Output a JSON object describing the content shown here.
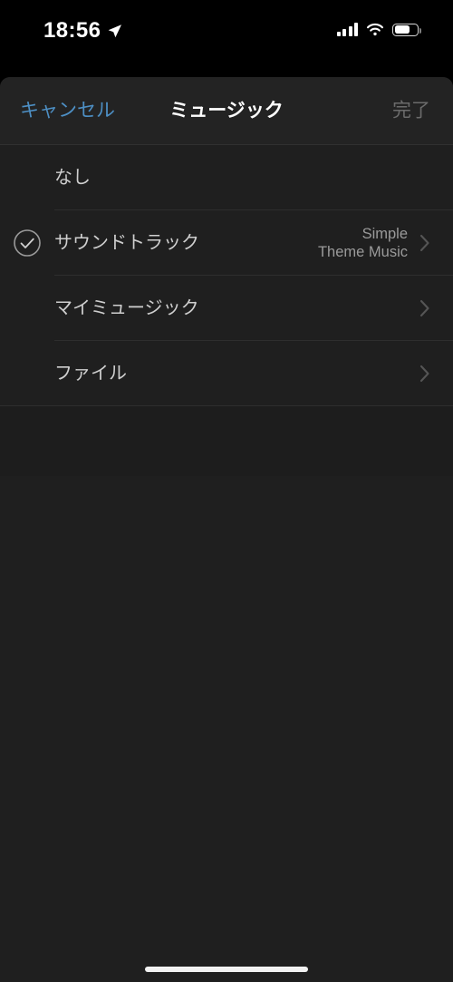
{
  "status_bar": {
    "time": "18:56",
    "location_icon": "location-arrow-icon",
    "signal_icon": "cellular-signal-icon",
    "signal_bars_filled": 4,
    "wifi_icon": "wifi-icon",
    "battery_icon": "battery-icon",
    "battery_level_percent": 62
  },
  "nav_bar": {
    "cancel_label": "キャンセル",
    "title": "ミュージック",
    "done_label": "完了",
    "cancel_color": "#4d8fc4",
    "done_color": "#6b6b6b",
    "title_color": "#ffffff"
  },
  "list": {
    "rows": [
      {
        "label": "なし",
        "value": "",
        "selected": false,
        "has_chevron": false
      },
      {
        "label": "サウンドトラック",
        "value": "Simple\nTheme Music",
        "selected": true,
        "has_chevron": true
      },
      {
        "label": "マイミュージック",
        "value": "",
        "selected": false,
        "has_chevron": true
      },
      {
        "label": "ファイル",
        "value": "",
        "selected": false,
        "has_chevron": true
      }
    ]
  },
  "home_indicator": {
    "color": "#f2f2f2"
  },
  "theme": {
    "background": "#000000",
    "sheet_background": "#1f1f1f",
    "nav_background": "#232323",
    "separator": "#2e2e2e",
    "label_color": "#cfcfcf",
    "value_color": "#9a9a9a",
    "chevron_color": "#555555",
    "check_color": "#9a9a9a"
  }
}
